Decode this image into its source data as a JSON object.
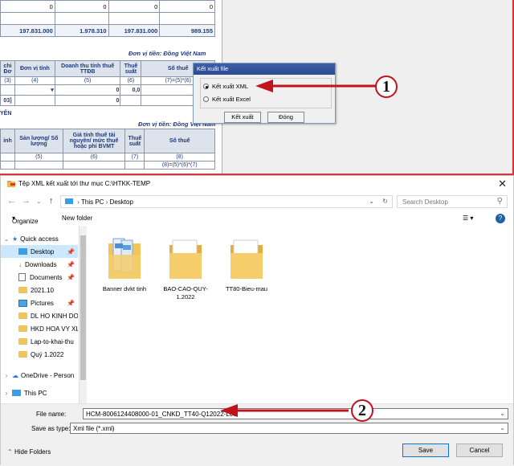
{
  "background_sheet": {
    "top_row_values": [
      "0",
      "0",
      "0",
      "0"
    ],
    "total_row_values": [
      "197.831.000",
      "1.978.310",
      "197.831.000",
      "989.155"
    ],
    "unit_label_1": "Đơn vị tiền: Đồng Việt Nam",
    "unit_label_2": "Đơn vị tiền: Đồng Việt Nam",
    "table1_headers": [
      "chi Đơ",
      "Đơn vị tính",
      "Doanh thu  tính thuế TTĐB",
      "Thuế suất",
      "Số thuế"
    ],
    "table1_numbers": [
      "(3)",
      "(4)",
      "(5)",
      "(6)",
      "(7)=(5)*(6)"
    ],
    "table1_row": [
      "",
      "",
      "0",
      "0,0",
      ""
    ],
    "table1_total": [
      "03]",
      "",
      "0",
      "",
      ""
    ],
    "section_label": "YÊN",
    "table2_headers": [
      "inh",
      "Sản lượng/ Số lượng",
      "Giá tính thuế tài nguyên/ mức thuế hoặc phí BVMT",
      "Thuế suất",
      "Số thuế"
    ],
    "table2_numbers": [
      "",
      "(5)",
      "(6)",
      "(7)",
      "(8)"
    ],
    "table2_formula": "(8)=(5)*(6)*(7)"
  },
  "export_dialog": {
    "title": "Kết xuất file",
    "option_xml": "Kết xuất XML",
    "option_excel": "Kết xuất Excel",
    "export_button": "Kết xuất",
    "close_button": "Đóng",
    "selected": "xml"
  },
  "callouts": {
    "one": "1",
    "two": "2"
  },
  "save_dialog": {
    "title": "Tệp XML kết xuất tới thư mục C:\\HTKK-TEMP",
    "breadcrumb": [
      "This PC",
      "Desktop"
    ],
    "search_placeholder": "Search Desktop",
    "organize_label": "Organize",
    "new_folder_label": "New folder",
    "nav_items": [
      {
        "label": "Quick access",
        "icon": "star-icon",
        "selected": false
      },
      {
        "label": "Desktop",
        "icon": "desktop-icon",
        "selected": true
      },
      {
        "label": "Downloads",
        "icon": "download-icon",
        "selected": false
      },
      {
        "label": "Documents",
        "icon": "document-icon",
        "selected": false
      },
      {
        "label": "2021.10",
        "icon": "folder-icon",
        "selected": false
      },
      {
        "label": "Pictures",
        "icon": "pictures-icon",
        "selected": false
      },
      {
        "label": "DL HO KINH DO",
        "icon": "folder-icon",
        "selected": false
      },
      {
        "label": "HKD HOA VY XL",
        "icon": "folder-icon",
        "selected": false
      },
      {
        "label": "Lap-to-khai-thu",
        "icon": "folder-icon",
        "selected": false
      },
      {
        "label": "Quý 1.2022",
        "icon": "folder-icon",
        "selected": false
      },
      {
        "label": "OneDrive - Person",
        "icon": "cloud-icon",
        "selected": false
      },
      {
        "label": "This PC",
        "icon": "computer-icon",
        "selected": false
      }
    ],
    "files": [
      "Banner dvkt tinh",
      "BAO-CAO-QUY-1.2022",
      "TT80-Bieu-mau"
    ],
    "file_name_label": "File name:",
    "file_name_value": "HCM-8006124408000-01_CNKD_TT40-Q12022-L00",
    "save_type_label": "Save as type:",
    "save_type_value": "Xml file (*.xml)",
    "hide_folders_label": "Hide Folders",
    "save_button": "Save",
    "cancel_button": "Cancel"
  },
  "colors": {
    "accent": "#0078d7",
    "callout_red": "#c2121c",
    "sheet_text": "#1f3a7a"
  }
}
